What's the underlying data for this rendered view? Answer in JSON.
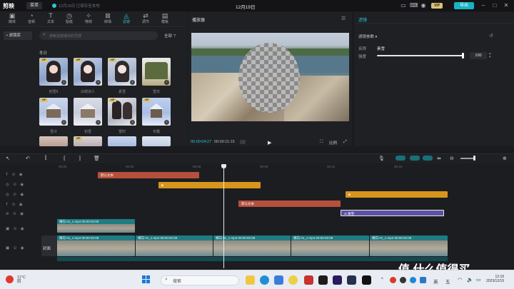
{
  "app": {
    "logo": "剪映",
    "menu": "菜单",
    "save_status": "12月19日 已保存至本地",
    "doc_title": "12月19日",
    "vip": "VIP",
    "export": "导出"
  },
  "tools": [
    {
      "label": "媒体",
      "icon": "media-icon"
    },
    {
      "label": "音频",
      "icon": "audio-icon"
    },
    {
      "label": "文本",
      "icon": "text-icon"
    },
    {
      "label": "贴纸",
      "icon": "sticker-icon"
    },
    {
      "label": "特效",
      "icon": "effects-icon"
    },
    {
      "label": "转场",
      "icon": "transition-icon"
    },
    {
      "label": "滤镜",
      "icon": "filter-icon"
    },
    {
      "label": "调节",
      "icon": "adjust-icon"
    },
    {
      "label": "模板",
      "icon": "template-icon"
    }
  ],
  "sidenav": {
    "item": "• 滤镜库"
  },
  "assets": {
    "search_placeholder": "搜索滤镜或你的灵感",
    "filter_label": "全部",
    "section": "冬日",
    "thumbs": [
      {
        "name": "初雪II",
        "vip": true
      },
      {
        "name": "白皑凉人",
        "vip": true
      },
      {
        "name": "素雪",
        "vip": true
      },
      {
        "name": "雪日",
        "vip": false
      },
      {
        "name": "雪冷",
        "vip": true
      },
      {
        "name": "初雪",
        "vip": false
      },
      {
        "name": "雪时",
        "vip": true
      },
      {
        "name": "冬酷",
        "vip": true
      },
      {
        "name": "",
        "vip": true
      },
      {
        "name": "",
        "vip": false
      },
      {
        "name": "",
        "vip": false
      },
      {
        "name": "",
        "vip": false
      }
    ]
  },
  "player": {
    "title": "播放器",
    "time_current": "00:00:04:27",
    "time_total": "00:00:11:15",
    "ratio": "比例"
  },
  "inspector": {
    "tab": "滤镜",
    "section": "滤镜参数",
    "name_label": "名称",
    "name_value": "素雪",
    "strength_label": "强度",
    "strength_value": "100",
    "strength_level": 1.0
  },
  "timeline": {
    "ticks": [
      "00:00",
      "00:03",
      "00:06",
      "00:09",
      "00:12",
      "00:15"
    ],
    "text_clips": [
      "默认文本",
      "默认文本"
    ],
    "filter_clip": "素雪",
    "video_clip_label": "横向 01_1.mp4  00:00:02:09",
    "cover": "封面"
  },
  "taskbar": {
    "weather_temp": "11°C",
    "weather_desc": "阴",
    "search": "搜索",
    "sys_lang": "英",
    "sys_day": "五",
    "time": "12:19",
    "date": "2023/12/19",
    "watermark": "值 什么值得买"
  },
  "colors": {
    "accent": "#2cc0cf",
    "text_clip": "#b5503c",
    "sticker_clip": "#d8951c",
    "filter_clip": "#5c52a4",
    "video_clip": "#1f7c83"
  }
}
